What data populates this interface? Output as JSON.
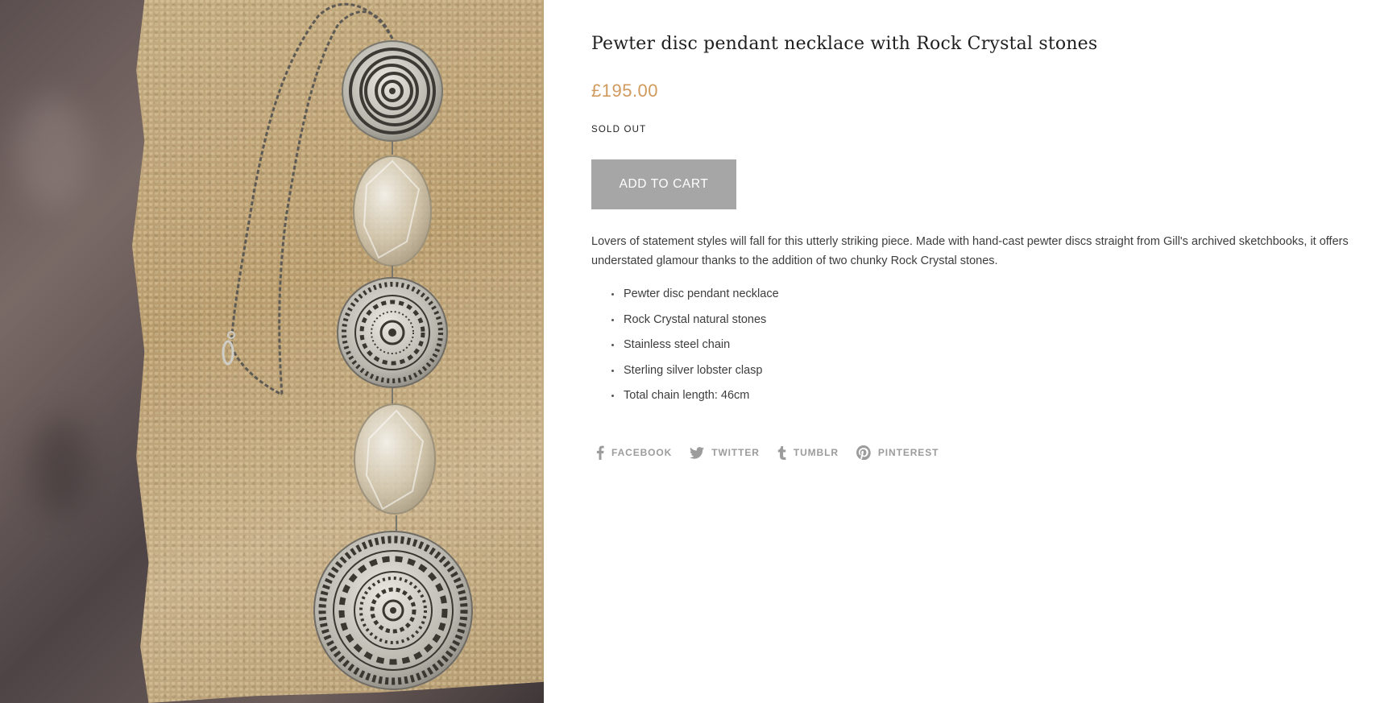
{
  "product": {
    "title": "Pewter disc pendant necklace with Rock Crystal stones",
    "price": "£195.00",
    "stock_status": "SOLD OUT",
    "add_to_cart_label": "ADD TO CART",
    "description": "Lovers of statement styles will fall for this utterly striking piece. Made with hand-cast pewter discs straight from Gill's archived sketchbooks, it offers understated glamour thanks to the addition of two chunky Rock Crystal stones.",
    "features": [
      "Pewter disc pendant necklace",
      "Rock Crystal natural stones",
      "Stainless steel chain",
      "Sterling silver lobster clasp",
      "Total chain length: 46cm"
    ]
  },
  "share": {
    "facebook": {
      "label": "FACEBOOK",
      "icon": "facebook-icon"
    },
    "twitter": {
      "label": "TWITTER",
      "icon": "twitter-icon"
    },
    "tumblr": {
      "label": "TUMBLR",
      "icon": "tumblr-icon"
    },
    "pinterest": {
      "label": "PINTEREST",
      "icon": "pinterest-icon"
    }
  },
  "colors": {
    "price": "#d09a5e",
    "button_bg": "#a6a6a6",
    "share_text": "#9c9c9c"
  }
}
